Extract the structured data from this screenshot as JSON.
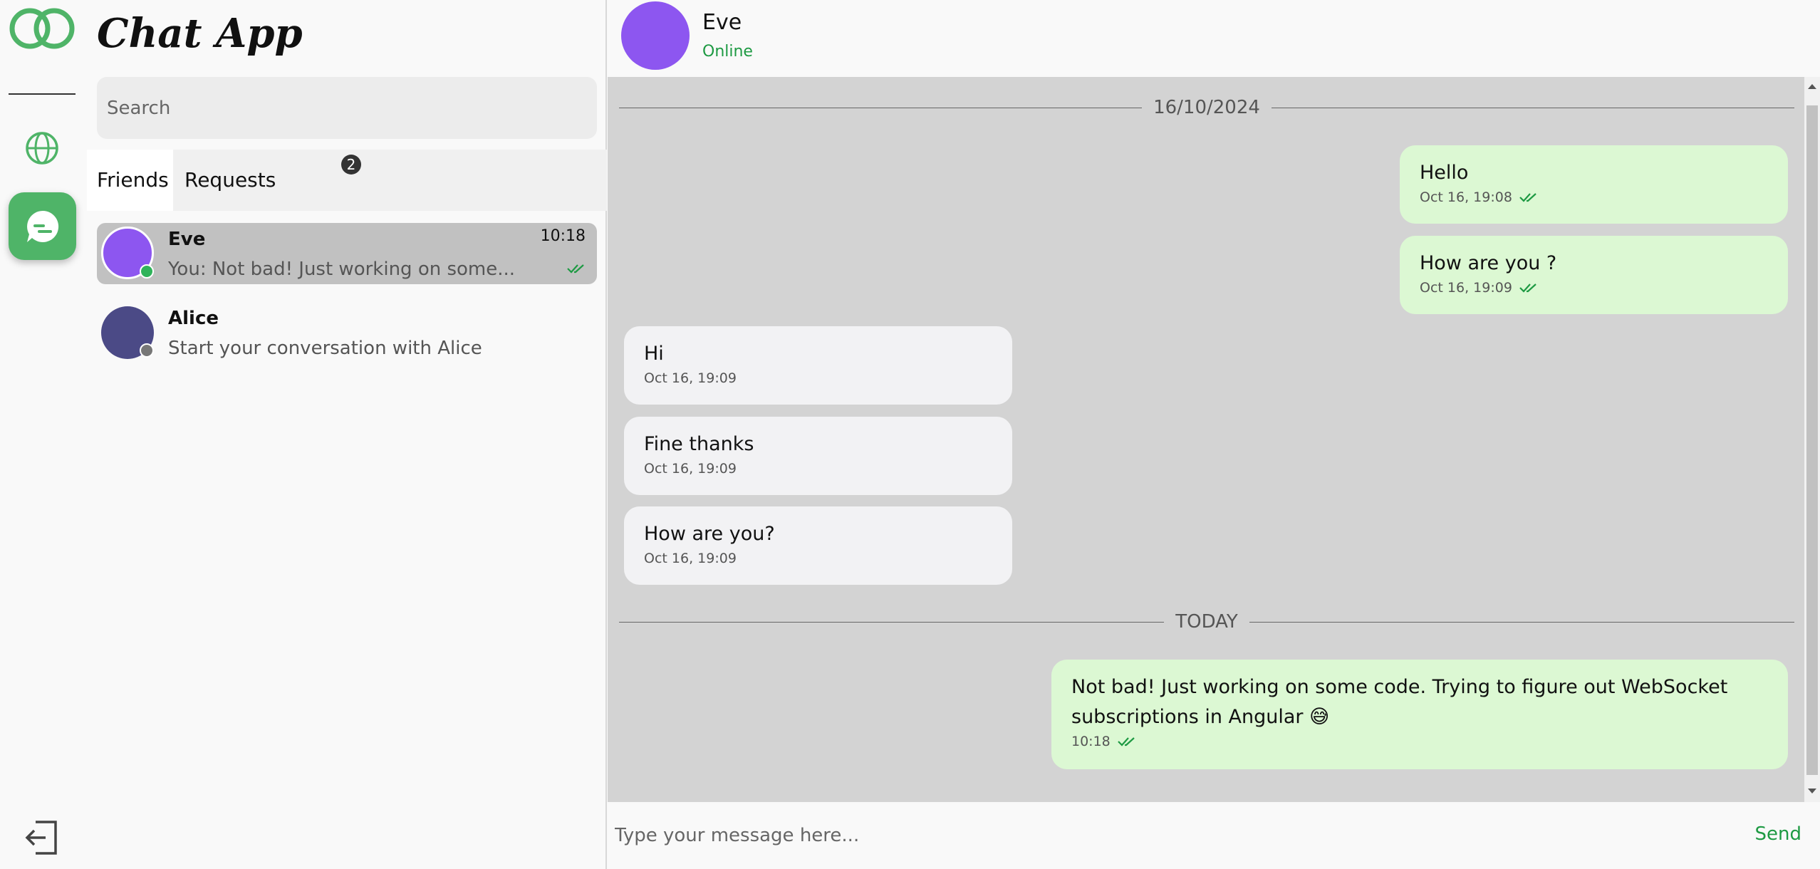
{
  "app": {
    "title": "Chat App"
  },
  "search": {
    "placeholder": "Search"
  },
  "tabs": [
    {
      "label": "Friends",
      "active": true
    },
    {
      "label": "Requests",
      "badge": "2"
    }
  ],
  "conversations": [
    {
      "name": "Eve",
      "preview": "You: Not bad! Just working on some...",
      "time": "10:18",
      "active": true,
      "online": true,
      "avatar_color": "#8d56f0",
      "read": true
    },
    {
      "name": "Alice",
      "preview": "Start your conversation with Alice",
      "time": "",
      "active": false,
      "online": false,
      "avatar_color": "#4b4a86"
    }
  ],
  "chat": {
    "contact_name": "Eve",
    "contact_status": "Online",
    "date_separators": [
      "16/10/2024",
      "TODAY"
    ],
    "messages": [
      {
        "text": "Hello",
        "time": "Oct 16, 19:08",
        "direction": "out",
        "read": true
      },
      {
        "text": "How are you ?",
        "time": "Oct 16, 19:09",
        "direction": "out",
        "read": true
      },
      {
        "text": "Hi",
        "time": "Oct 16, 19:09",
        "direction": "in"
      },
      {
        "text": "Fine thanks",
        "time": "Oct 16, 19:09",
        "direction": "in"
      },
      {
        "text": "How are you?",
        "time": "Oct 16, 19:09",
        "direction": "in"
      },
      {
        "text": "Not bad! Just working on some code. Trying to figure out WebSocket subscriptions in Angular 😅",
        "time": "10:18",
        "direction": "out",
        "read": true
      }
    ]
  },
  "composer": {
    "placeholder": "Type your message here...",
    "send_label": "Send"
  },
  "icons": {
    "logo": "logo-rings-icon",
    "globe": "globe-icon",
    "chat": "chat-bubble-icon",
    "logout": "logout-icon",
    "read_receipt": "double-check-icon"
  },
  "colors": {
    "accent": "#4fb468",
    "online": "#1e9a43",
    "outgoing_bubble": "#dcf8d3",
    "incoming_bubble": "#f2f2f4",
    "chat_background": "#d3d3d3"
  }
}
